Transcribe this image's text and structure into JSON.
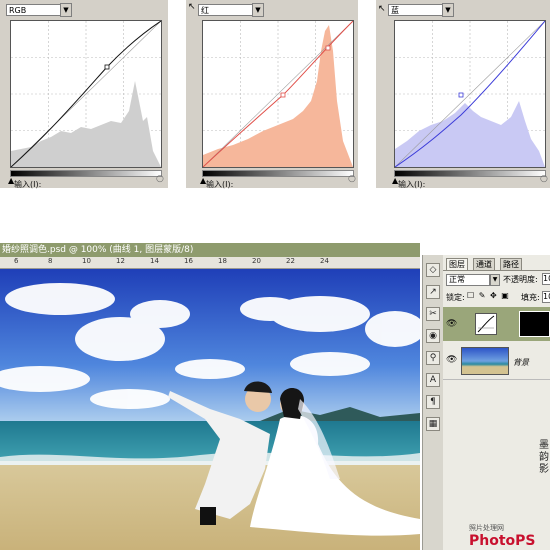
{
  "curves": [
    {
      "channel": "RGB",
      "input_label": "输入(I):",
      "color": "#111111",
      "hist": "#cfcfcf"
    },
    {
      "channel": "红",
      "input_label": "输入(I):",
      "color": "#e0504a",
      "hist": "#f6b79b"
    },
    {
      "channel": "蓝",
      "input_label": "输入(I):",
      "color": "#3c3cd8",
      "hist": "#c9c9f4"
    }
  ],
  "document": {
    "title": "婚纱照调色.psd @ 100% (曲线 1, 图层蒙版/8)",
    "ruler_ticks": [
      "6",
      "8",
      "10",
      "12",
      "14",
      "16",
      "18",
      "20",
      "22",
      "24"
    ]
  },
  "layers_panel": {
    "tabs": [
      "图层",
      "通道",
      "路径"
    ],
    "blend_mode": "正常",
    "opacity_label": "不透明度:",
    "opacity_value": "10",
    "lock_label": "锁定:",
    "fill_label": "填充:",
    "fill_value": "10",
    "background_layer": "背景"
  },
  "watermark": {
    "site": "照片处理网",
    "brand": "PhotoPS"
  },
  "tools": [
    "◇",
    "↗",
    "✂",
    "◉",
    "⚲",
    "A",
    "¶",
    "▦"
  ],
  "colors": {
    "panel_bg": "#d4d0c8",
    "title_bar": "#8e9b6d",
    "layers_bg": "#ecebe4"
  }
}
